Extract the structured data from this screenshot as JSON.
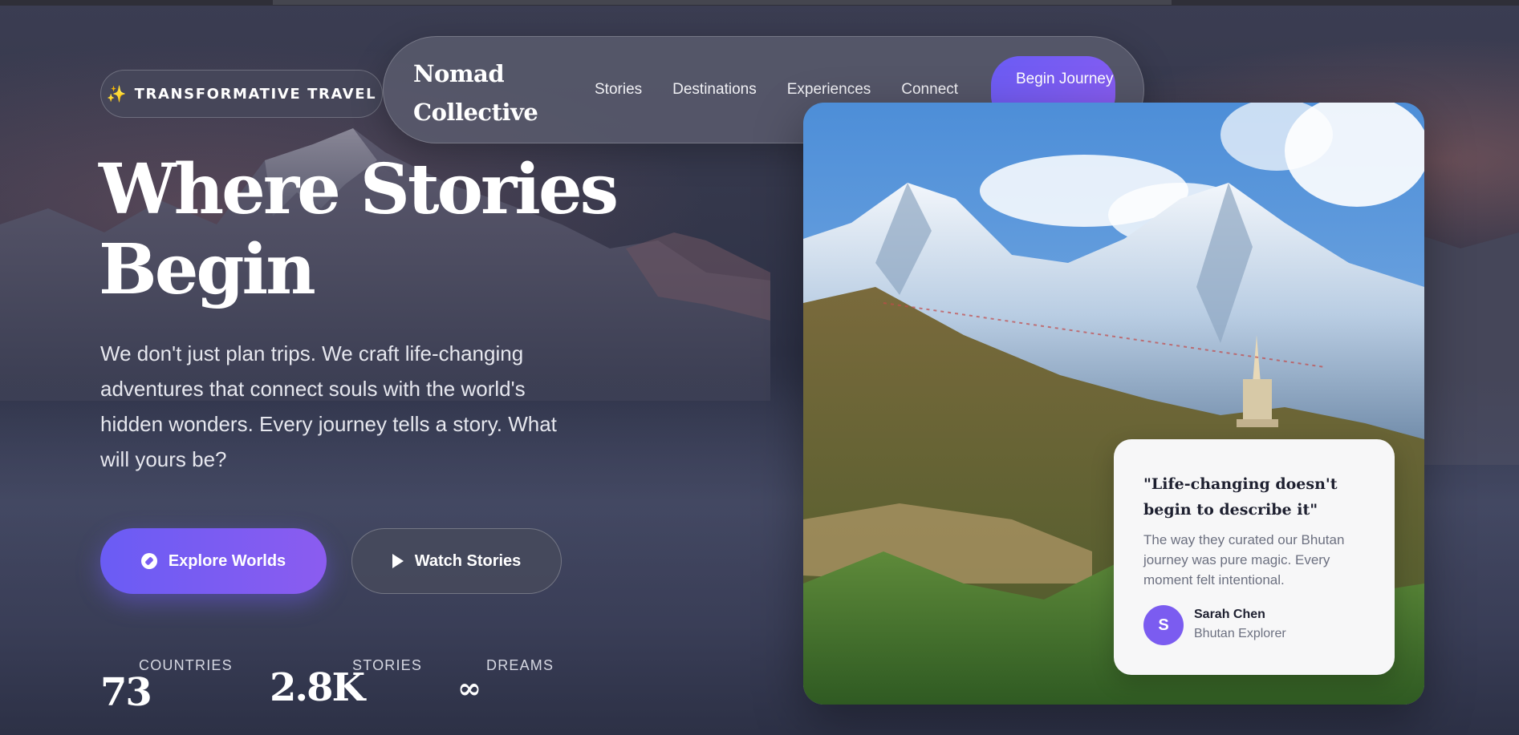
{
  "badge": {
    "icon": "sparkle-icon",
    "text": "TRANSFORMATIVE TRAVEL"
  },
  "nav": {
    "brand": "Nomad Collective",
    "links": [
      "Stories",
      "Destinations",
      "Experiences",
      "Connect"
    ],
    "cta": "Begin Journey"
  },
  "hero": {
    "title": "Where Stories Begin",
    "description": "We don't just plan trips. We craft life-changing adventures that connect souls with the world's hidden wonders. Every journey tells a story. What will yours be?",
    "primary_button": "Explore Worlds",
    "secondary_button": "Watch Stories"
  },
  "stats": [
    {
      "label": "COUNTRIES",
      "value": "73"
    },
    {
      "label": "STORIES",
      "value": "2.8K"
    },
    {
      "label": "DREAMS",
      "value": "∞"
    }
  ],
  "testimonial": {
    "quote": "\"Life-changing doesn't begin to describe it\"",
    "body": "The way they curated our Bhutan journey was pure magic. Every moment felt intentional.",
    "avatar_initial": "S",
    "name": "Sarah Chen",
    "role": "Bhutan Explorer"
  },
  "colors": {
    "accent": "#6a5cf4",
    "accent_end": "#8b5cf0",
    "sparkle": "#f6c043"
  }
}
